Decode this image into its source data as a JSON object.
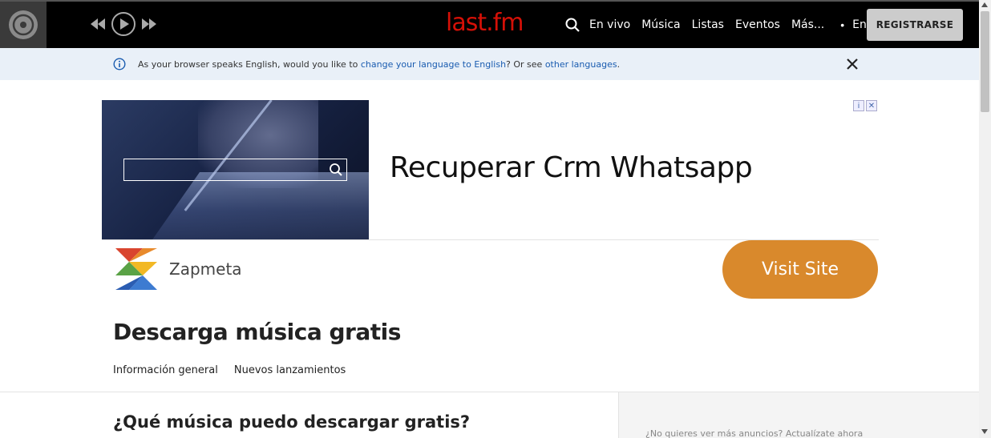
{
  "header": {
    "logo": "last.fm",
    "search_icon": "search-icon",
    "nav": [
      "En vivo",
      "Música",
      "Listas",
      "Eventos",
      "Más..."
    ],
    "separator": "•",
    "login": "Entrar",
    "register": "REGISTRARSE",
    "player": {
      "disc_icon": "vinyl-disc-icon",
      "prev_icon": "rewind-icon",
      "play_icon": "play-icon",
      "next_icon": "fast-forward-icon"
    },
    "colors": {
      "background": "#000000",
      "logo": "#d51007",
      "register_bg": "#cccccc"
    }
  },
  "language_banner": {
    "text_before": "As your browser speaks English, would you like to ",
    "link_change": "change your language to English",
    "text_middle": "? Or see ",
    "link_other": "other languages",
    "text_after": ".",
    "info_icon": "info-icon",
    "close_icon": "close-icon",
    "background": "#e9f0f8"
  },
  "ad": {
    "headline": "Recuperar Crm Whatsapp",
    "brand": "Zapmeta",
    "cta": "Visit Site",
    "adchoices_info": "i",
    "adchoices_close": "✕",
    "cta_color": "#d9892c"
  },
  "main": {
    "title": "Descarga música gratis",
    "tabs": [
      "Información general",
      "Nuevos lanzamientos"
    ],
    "section_title": "¿Qué música puedo descargar gratis?"
  },
  "sidebar": {
    "note": "¿No quieres ver más anuncios? Actualízate ahora"
  }
}
